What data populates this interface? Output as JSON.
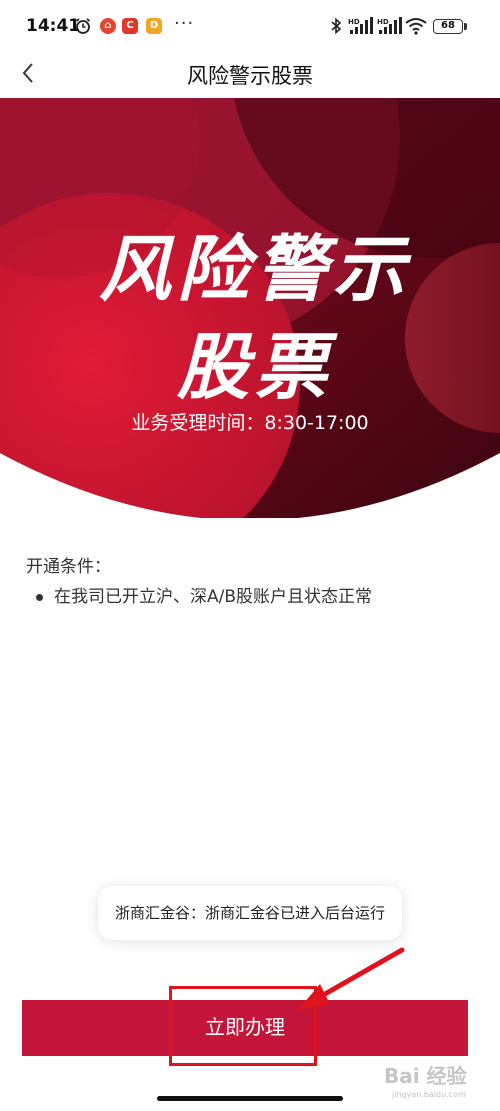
{
  "status_bar": {
    "time": "14:41",
    "more": "···",
    "battery": "68",
    "app_badges": [
      "⌂",
      "C",
      "D"
    ],
    "icons": [
      "alarm-icon",
      "bluetooth-icon",
      "signal-hd-icon",
      "signal-hd-icon",
      "wifi-icon",
      "battery-icon"
    ]
  },
  "nav": {
    "title": "风险警示股票",
    "back_icon": "chevron-left-icon"
  },
  "banner": {
    "title_line1": "风险警示",
    "title_line2": "股票",
    "hours": "业务受理时间：8:30-17:00",
    "colors": {
      "dark": "#5a0614",
      "mid": "#8b0f25",
      "bright": "#d01a36"
    }
  },
  "conditions": {
    "title": "开通条件：",
    "items": [
      "在我司已开立沪、深A/B股账户且状态正常"
    ]
  },
  "toast": {
    "text": "浙商汇金谷：浙商汇金谷已进入后台运行"
  },
  "action": {
    "label": "立即办理",
    "color": "#c4163a"
  },
  "watermark": {
    "text": "Bai 经验",
    "sub": "jingyan.baidu.com"
  }
}
